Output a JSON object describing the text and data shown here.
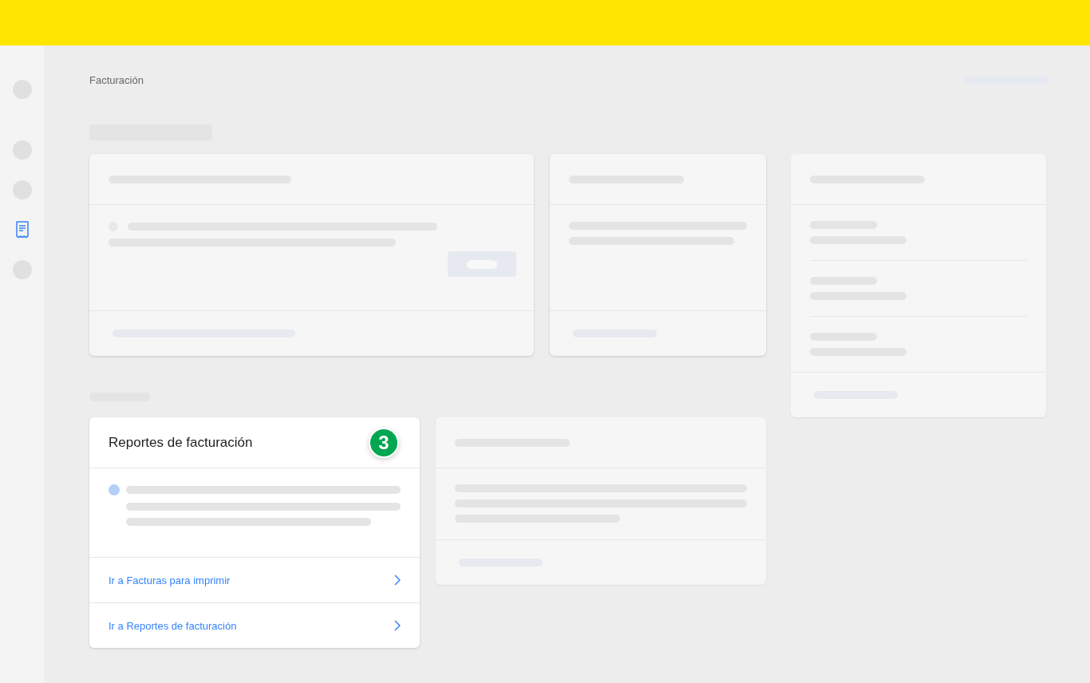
{
  "sidebar": {
    "items": [
      {
        "selected": false
      },
      {
        "selected": false
      },
      {
        "selected": false
      },
      {
        "selected": true
      },
      {
        "selected": false
      }
    ]
  },
  "breadcrumb": "Facturación",
  "reports_card": {
    "title": "Reportes de facturación",
    "badge": "3",
    "links": [
      {
        "label": "Ir a Facturas para imprimir"
      },
      {
        "label": "Ir a Reportes de facturación"
      }
    ]
  }
}
